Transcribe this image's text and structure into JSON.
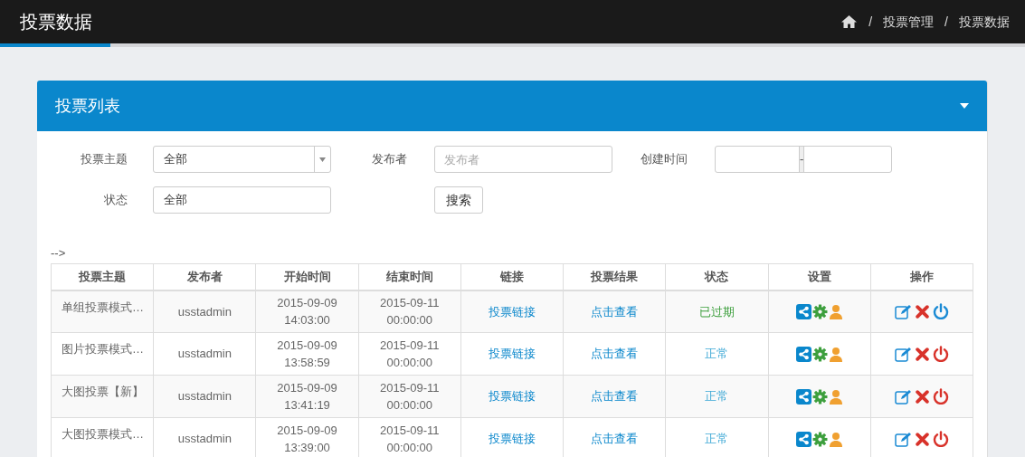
{
  "page_title": "投票数据",
  "breadcrumb": [
    {
      "separator": "/",
      "label": "投票管理"
    },
    {
      "separator": "/",
      "label": "投票数据"
    }
  ],
  "panel": {
    "title": "投票列表",
    "expanded": true
  },
  "filters": {
    "topic_label": "投票主题",
    "topic_value": "全部",
    "publisher_label": "发布者",
    "publisher_placeholder": "发布者",
    "created_label": "创建时间",
    "range_separator": "-",
    "status_label": "状态",
    "status_value": "全部",
    "search_button": "搜索"
  },
  "stray_text": "-->",
  "table": {
    "columns": [
      "投票主题",
      "发布者",
      "开始时间",
      "结束时间",
      "链接",
      "投票结果",
      "状态",
      "设置",
      "操作"
    ],
    "rows": [
      {
        "topic": "单组投票模式…",
        "publisher": "usstadmin",
        "start": [
          "2015-09-09",
          "14:03:00"
        ],
        "end": [
          "2015-09-11",
          "00:00:00"
        ],
        "link": "投票链接",
        "result": "点击查看",
        "status": "已过期",
        "expired": true,
        "enabled": false
      },
      {
        "topic": "图片投票模式…",
        "publisher": "usstadmin",
        "start": [
          "2015-09-09",
          "13:58:59"
        ],
        "end": [
          "2015-09-11",
          "00:00:00"
        ],
        "link": "投票链接",
        "result": "点击查看",
        "status": "正常",
        "expired": false,
        "enabled": true
      },
      {
        "topic": "大图投票【新】",
        "publisher": "usstadmin",
        "start": [
          "2015-09-09",
          "13:41:19"
        ],
        "end": [
          "2015-09-11",
          "00:00:00"
        ],
        "link": "投票链接",
        "result": "点击查看",
        "status": "正常",
        "expired": false,
        "enabled": true
      },
      {
        "topic": "大图投票模式…",
        "publisher": "usstadmin",
        "start": [
          "2015-09-09",
          "13:39:00"
        ],
        "end": [
          "2015-09-11",
          "00:00:00"
        ],
        "link": "投票链接",
        "result": "点击查看",
        "status": "正常",
        "expired": false,
        "enabled": true
      }
    ]
  }
}
